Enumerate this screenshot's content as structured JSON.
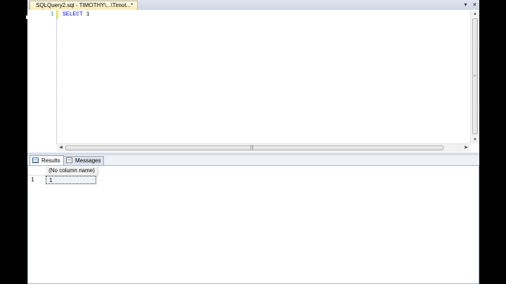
{
  "document_tab": {
    "title": "SQLQuery2.sql - TIMOTHY\\...\\Timot...*"
  },
  "tab_controls": {
    "dropdown_glyph": "▾",
    "close_glyph": "×"
  },
  "editor": {
    "lines": [
      {
        "number": "1",
        "keyword": "SELECT",
        "value": "1"
      }
    ]
  },
  "scrollbars": {
    "up_glyph": "▲",
    "down_glyph": "▼",
    "left_glyph": "◀",
    "right_glyph": "▶",
    "grip_glyph": "|||"
  },
  "results_tabs": [
    {
      "label": "Results",
      "icon": "grid-icon",
      "active": true
    },
    {
      "label": "Messages",
      "icon": "messages-icon",
      "active": false
    }
  ],
  "results_grid": {
    "columns": [
      "(No column name)"
    ],
    "rows": [
      {
        "row_number": "1",
        "values": [
          "1"
        ]
      }
    ]
  }
}
